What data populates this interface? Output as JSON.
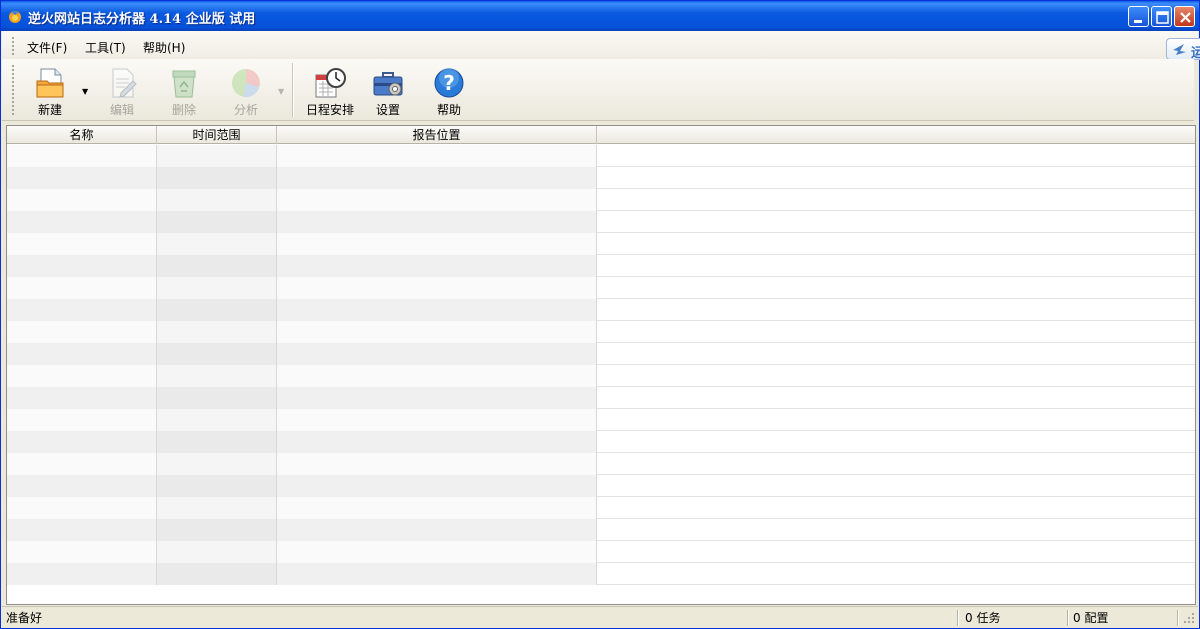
{
  "window": {
    "title": "逆火网站日志分析器 4.14 企业版 试用"
  },
  "menubar": {
    "items": [
      {
        "label": "文件(F)"
      },
      {
        "label": "工具(T)"
      },
      {
        "label": "帮助(H)"
      }
    ]
  },
  "toolbar": {
    "new_label": "新建",
    "edit_label": "编辑",
    "delete_label": "删除",
    "analyze_label": "分析",
    "schedule_label": "日程安排",
    "settings_label": "设置",
    "help_label": "帮助"
  },
  "side_tab": {
    "label": "运"
  },
  "grid": {
    "columns": [
      "名称",
      "时间范围",
      "报告位置",
      ""
    ],
    "row_count": 20
  },
  "statusbar": {
    "status": "准备好",
    "tasks": "0 任务",
    "configs": "0 配置"
  },
  "colors": {
    "titlebar": "#0a5ae0",
    "window_bg": "#ece9d8",
    "disabled_text": "#a8a69c"
  }
}
